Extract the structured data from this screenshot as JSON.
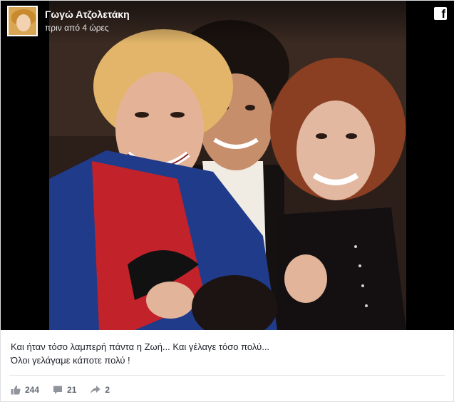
{
  "post": {
    "author": "Γωγώ Ατζολετάκη",
    "time": "πριν από 4 ώρες",
    "platform_icon": "facebook-icon",
    "caption_lines": [
      "Και ήταν τόσο λαμπερή πάντα η Ζωή... Και γέλαγε τόσο πολύ...",
      "Όλοι γελάγαμε κάποτε πολύ !"
    ],
    "stats": {
      "likes": "244",
      "comments": "21",
      "shares": "2"
    }
  },
  "colors": {
    "meta_text": "#606770",
    "caption_text": "#1d2129",
    "border": "#dddfe2"
  }
}
